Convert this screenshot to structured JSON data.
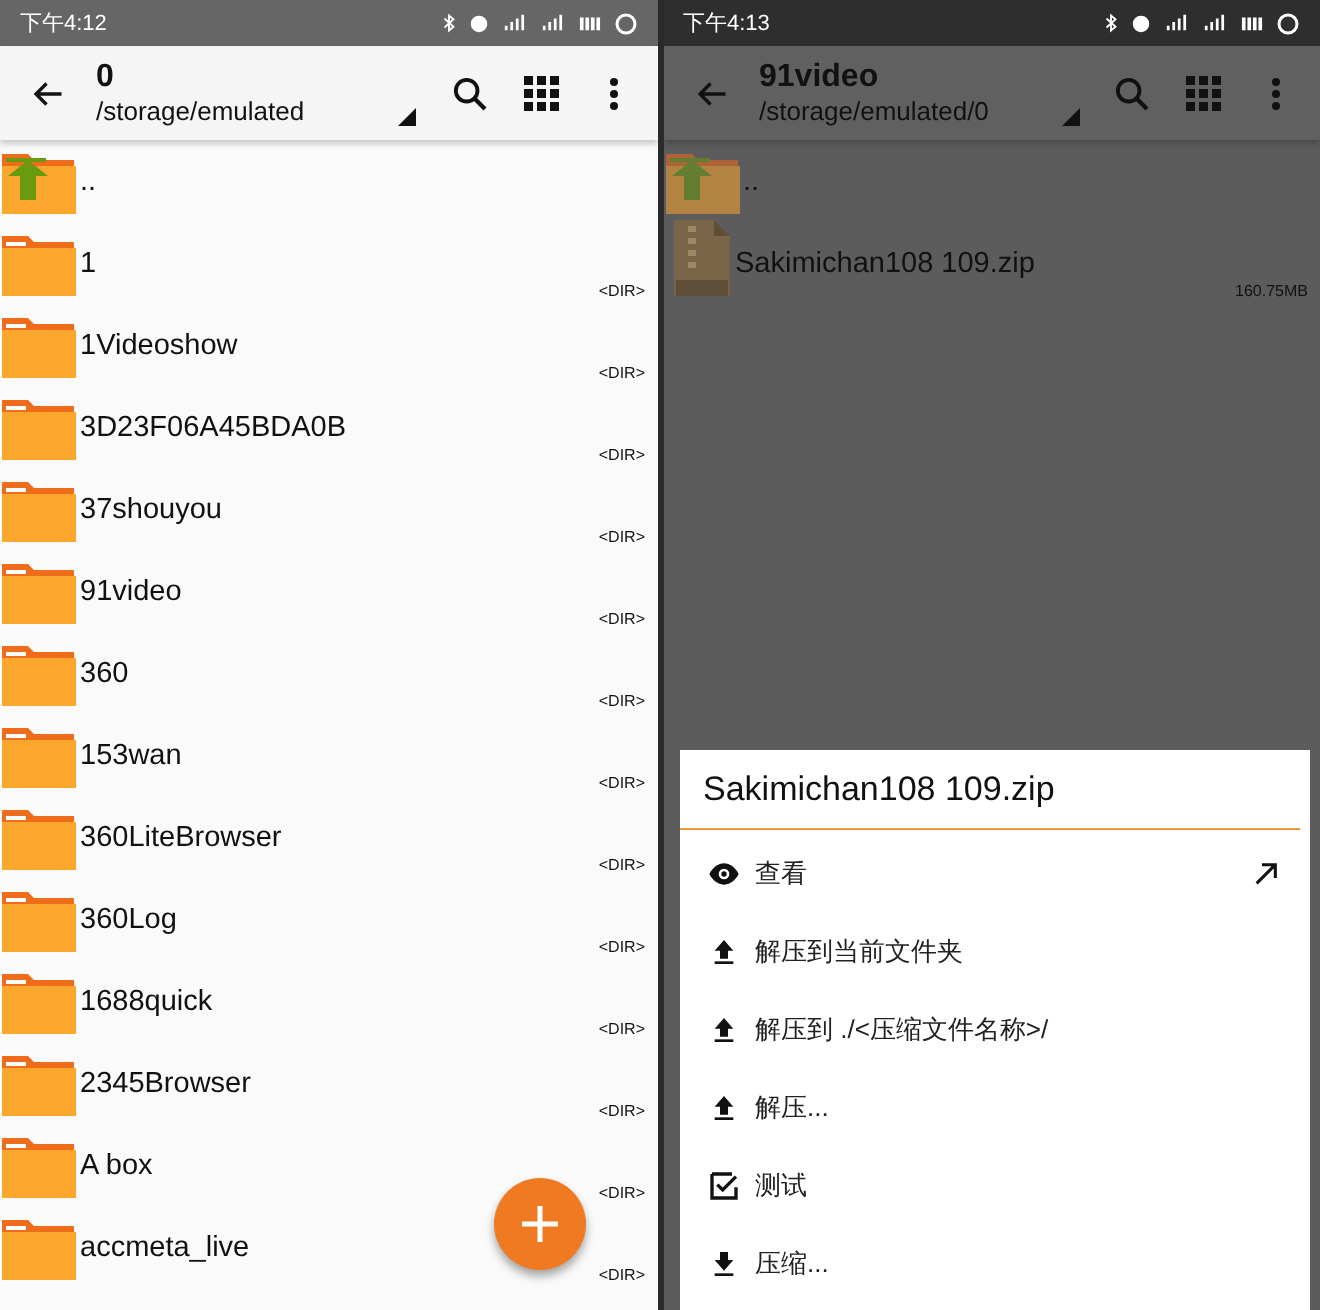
{
  "screens": [
    {
      "dimmed": false,
      "status_bar": {
        "time": "下午4:12"
      },
      "toolbar": {
        "title": "0",
        "path": "/storage/emulated"
      },
      "fab": true,
      "rows": [
        {
          "kind": "up",
          "name": ".."
        },
        {
          "kind": "folder",
          "name": "1",
          "size": "<DIR>"
        },
        {
          "kind": "folder",
          "name": "1Videoshow",
          "size": "<DIR>"
        },
        {
          "kind": "folder",
          "name": "3D23F06A45BDA0B",
          "size": "<DIR>"
        },
        {
          "kind": "folder",
          "name": "37shouyou",
          "size": "<DIR>"
        },
        {
          "kind": "folder",
          "name": "91video",
          "size": "<DIR>"
        },
        {
          "kind": "folder",
          "name": "360",
          "size": "<DIR>"
        },
        {
          "kind": "folder",
          "name": "153wan",
          "size": "<DIR>"
        },
        {
          "kind": "folder",
          "name": "360LiteBrowser",
          "size": "<DIR>"
        },
        {
          "kind": "folder",
          "name": "360Log",
          "size": "<DIR>"
        },
        {
          "kind": "folder",
          "name": "1688quick",
          "size": "<DIR>"
        },
        {
          "kind": "folder",
          "name": "2345Browser",
          "size": "<DIR>"
        },
        {
          "kind": "folder",
          "name": "A box",
          "size": "<DIR>"
        },
        {
          "kind": "folder",
          "name": "accmeta_live",
          "size": "<DIR>"
        }
      ]
    },
    {
      "dimmed": true,
      "status_bar": {
        "time": "下午4:13"
      },
      "toolbar": {
        "title": "91video",
        "path": "/storage/emulated/0"
      },
      "rows": [
        {
          "kind": "up",
          "name": ".."
        },
        {
          "kind": "zip",
          "name": "Sakimichan108 109.zip",
          "size": "160.75MB"
        }
      ],
      "sheet": {
        "title": "Sakimichan108 109.zip",
        "items": [
          {
            "kind": "view",
            "label": "查看",
            "shortcut": true
          },
          {
            "kind": "extract",
            "label": "解压到当前文件夹",
            "shortcut": false
          },
          {
            "kind": "extract",
            "label": "解压到 ./<压缩文件名称>/",
            "shortcut": false
          },
          {
            "kind": "extract",
            "label": "解压...",
            "shortcut": false
          },
          {
            "kind": "test",
            "label": "测试",
            "shortcut": false
          },
          {
            "kind": "compress",
            "label": "压缩...",
            "shortcut": false
          }
        ]
      }
    }
  ]
}
